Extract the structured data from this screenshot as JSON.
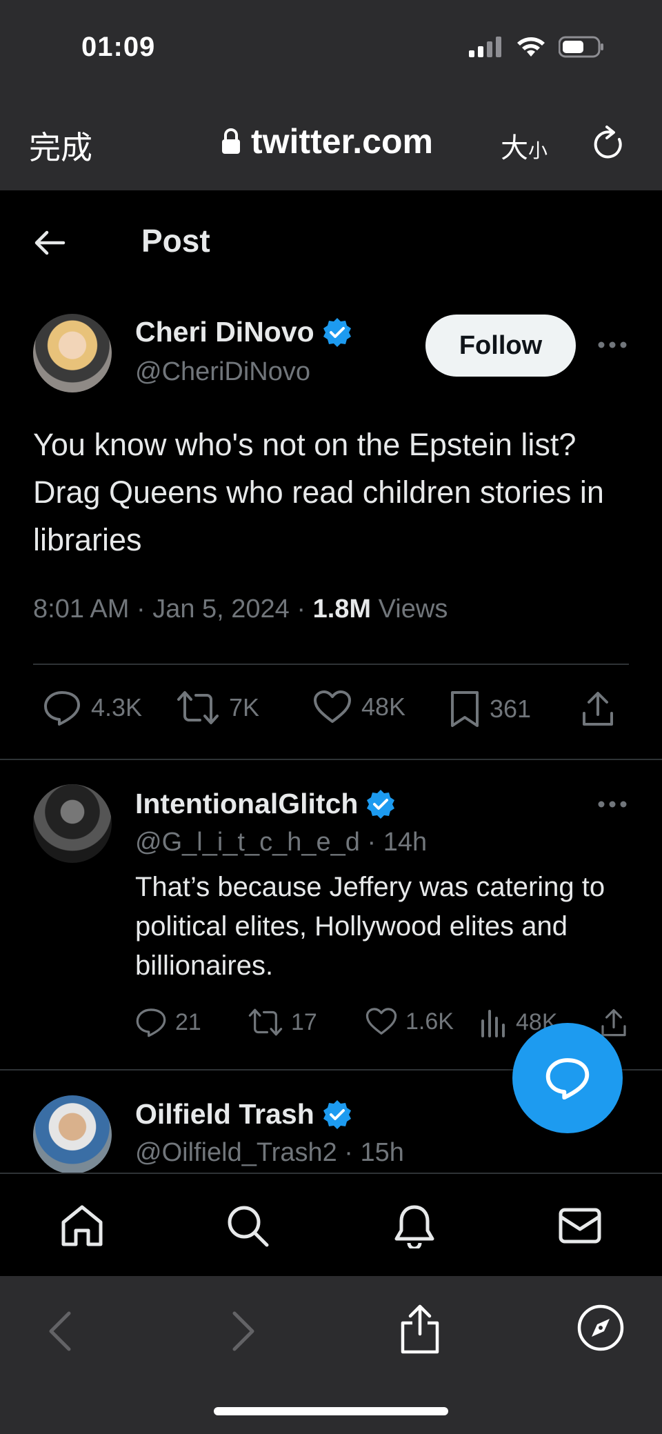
{
  "status_bar": {
    "time": "01:09"
  },
  "browser": {
    "done_label": "完成",
    "url": "twitter.com",
    "text_size_big": "大",
    "text_size_small": "小"
  },
  "header": {
    "title": "Post"
  },
  "main_tweet": {
    "name": "Cheri DiNovo",
    "handle": "@CheriDiNovo",
    "follow_label": "Follow",
    "text": "You know who's not on the Epstein list? Drag Queens who read children stories in libraries",
    "time": "8:01 AM",
    "date": "Jan 5, 2024",
    "views_count": "1.8M",
    "views_label": "Views",
    "replies": "4.3K",
    "reposts": "7K",
    "likes": "48K",
    "bookmarks": "361"
  },
  "replies": [
    {
      "name": "IntentionalGlitch",
      "handle": "@G_l_i_t_c_h_e_d",
      "age": "14h",
      "text": "That’s because Jeffery was catering to political elites, Hollywood elites and billionaires.",
      "replies": "21",
      "reposts": "17",
      "likes": "1.6K",
      "views": "48K"
    },
    {
      "name": "Oilfield Trash",
      "handle": "@Oilfield_Trash2",
      "age": "15h"
    }
  ],
  "colors": {
    "accent": "#1d9bf0",
    "muted": "#71767b",
    "text": "#e7e9ea"
  }
}
